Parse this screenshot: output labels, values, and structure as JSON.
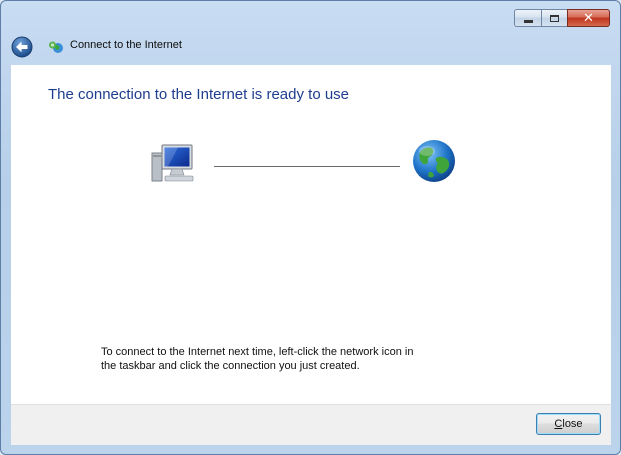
{
  "window": {
    "title": "Connect to the Internet"
  },
  "content": {
    "heading": "The connection to the Internet is ready to use",
    "instructions_line1": "To connect to the Internet next time, left-click the network icon in",
    "instructions_line2": "the taskbar and click the connection you just created."
  },
  "footer": {
    "close_mnemonic": "C",
    "close_rest": "lose"
  },
  "icons": {
    "back": "back-arrow-icon",
    "title": "network-globe-icon",
    "computer": "computer-icon",
    "globe": "globe-icon"
  },
  "colors": {
    "heading": "#1e3d8f",
    "accent": "#3c7fb1"
  }
}
